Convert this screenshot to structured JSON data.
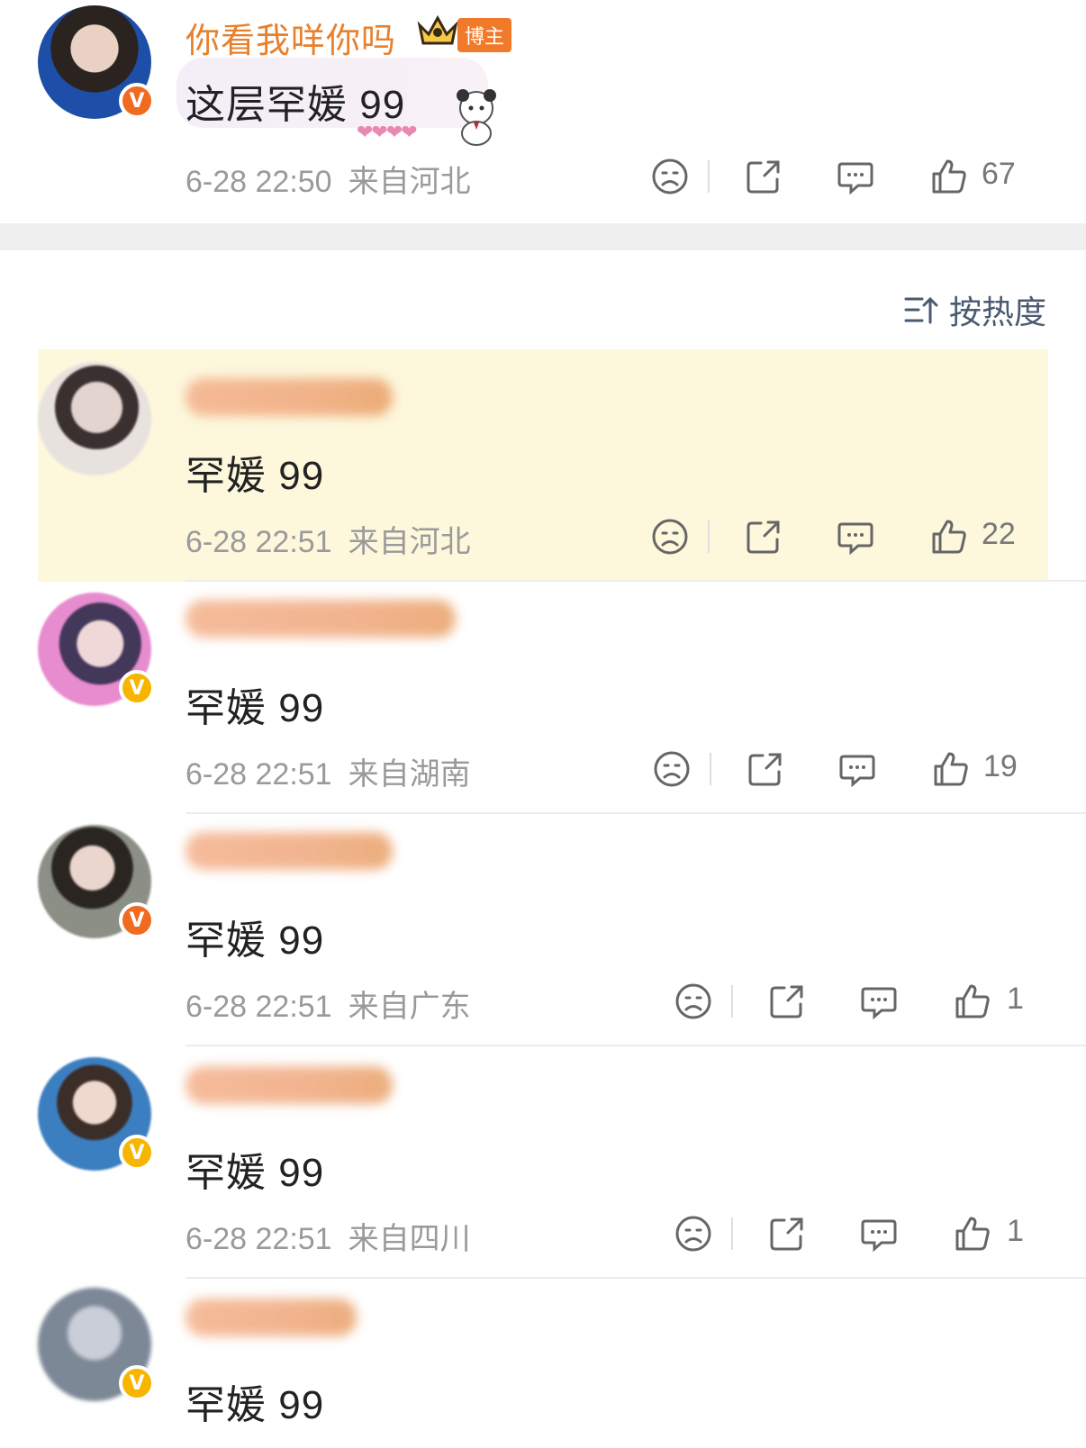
{
  "post": {
    "author": "你看我咩你吗",
    "tag": "博主",
    "text": "这层罕媛 99",
    "time": "6-28 22:50",
    "location": "来自河北",
    "likes": "67"
  },
  "sort": {
    "label": "按热度"
  },
  "comments": [
    {
      "text": "罕媛 99",
      "time": "6-28 22:51",
      "location": "来自河北",
      "likes": "22"
    },
    {
      "text": "罕媛 99",
      "time": "6-28 22:51",
      "location": "来自湖南",
      "likes": "19"
    },
    {
      "text": "罕媛 99",
      "time": "6-28 22:51",
      "location": "来自广东",
      "likes": "1"
    },
    {
      "text": "罕媛 99",
      "time": "6-28 22:51",
      "location": "来自四川",
      "likes": "1"
    },
    {
      "text": "罕媛 99"
    }
  ],
  "colors": {
    "accent": "#e8802c",
    "highlight": "#fdf7dc",
    "meta": "#9a9a9a"
  },
  "icons": [
    "sad-face-icon",
    "share-icon",
    "comment-icon",
    "thumbs-up-icon",
    "sort-icon",
    "crown-icon",
    "verified-icon"
  ]
}
